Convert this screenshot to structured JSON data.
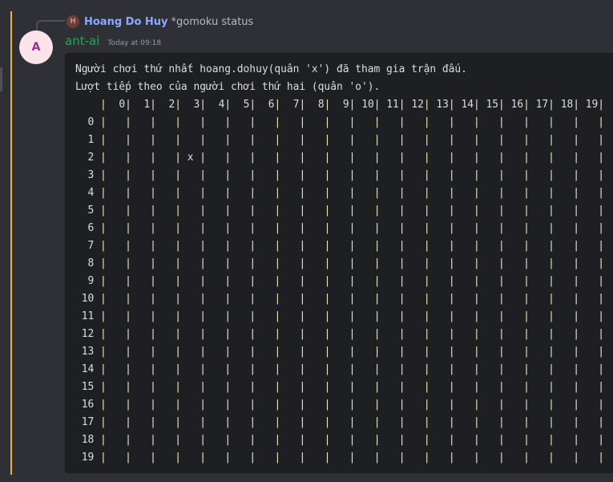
{
  "reply": {
    "avatar_letter": "H",
    "author": "Hoang Do Huy",
    "text": "*gomoku status"
  },
  "message": {
    "avatar_letter": "A",
    "author": "ant-ai",
    "timestamp": "Today at 09:18",
    "lines": [
      "Người chơi thứ nhất hoang.dohuy(quân 'x') đã tham gia trận đấu.",
      "Lượt tiếp theo của người chơi thứ hai (quân 'o')."
    ]
  },
  "board": {
    "columns": [
      "0",
      "1",
      "2",
      "3",
      "4",
      "5",
      "6",
      "7",
      "8",
      "9",
      "10",
      "11",
      "12",
      "13",
      "14",
      "15",
      "16",
      "17",
      "18",
      "19"
    ],
    "rows": [
      "0",
      "1",
      "2",
      "3",
      "4",
      "5",
      "6",
      "7",
      "8",
      "9",
      "10",
      "11",
      "12",
      "13",
      "14",
      "15",
      "16",
      "17",
      "18",
      "19"
    ],
    "pieces": [
      {
        "row": 2,
        "col": 3,
        "mark": "x"
      }
    ]
  },
  "colors": {
    "highlight": "#f0b232",
    "author": "#23a559",
    "reply_name": "#8ea8ff",
    "code_bg": "#1e1f22"
  }
}
